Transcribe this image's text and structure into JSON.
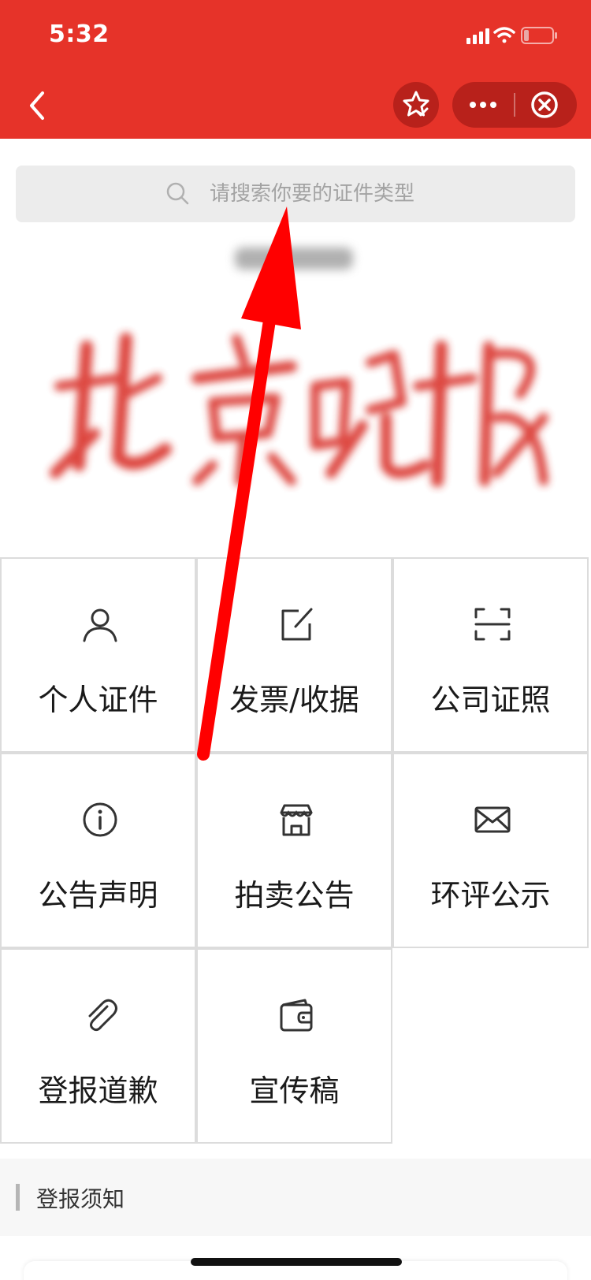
{
  "status_bar": {
    "time": "5:32"
  },
  "nav": {
    "back_icon": "chevron-left-icon",
    "favorite_icon": "star-check-icon",
    "more_icon": "ellipsis-icon",
    "close_icon": "close-circle-icon"
  },
  "search": {
    "placeholder": "请搜索你要的证件类型",
    "icon": "search-icon"
  },
  "banner": {
    "calligraphy": "北京晚报"
  },
  "grid": {
    "items": [
      {
        "label": "个人证件",
        "icon": "person-icon"
      },
      {
        "label": "发票/收据",
        "icon": "edit-icon"
      },
      {
        "label": "公司证照",
        "icon": "scan-icon"
      },
      {
        "label": "公告声明",
        "icon": "info-icon"
      },
      {
        "label": "拍卖公告",
        "icon": "store-icon"
      },
      {
        "label": "环评公示",
        "icon": "mail-icon"
      },
      {
        "label": "登报道歉",
        "icon": "paperclip-icon"
      },
      {
        "label": "宣传稿",
        "icon": "wallet-icon"
      }
    ]
  },
  "notice": {
    "label": "登报须知"
  },
  "colors": {
    "header": "#e63329",
    "capsule": "#b8211b",
    "arrow": "#ff0000"
  }
}
